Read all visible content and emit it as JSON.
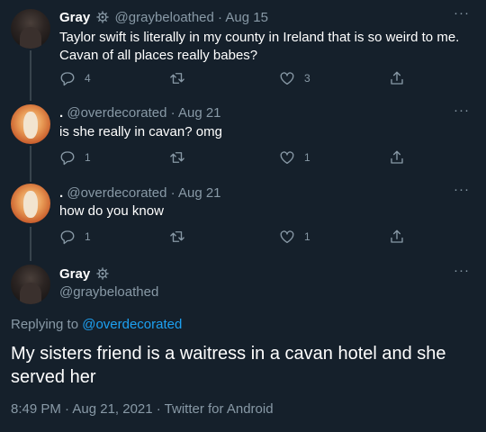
{
  "tweets": [
    {
      "name": "Gray",
      "handle": "@graybeloathed",
      "date": "Aug 15",
      "text_lines": [
        "Taylor swift is literally in my county in Ireland that is so weird to me.",
        "Cavan of all places really babes?"
      ],
      "replies": "4",
      "retweets": "",
      "likes": "3"
    },
    {
      "name": ".",
      "handle": "@overdecorated",
      "date": "Aug 21",
      "text_lines": [
        "is she really in cavan? omg"
      ],
      "replies": "1",
      "retweets": "",
      "likes": "1"
    },
    {
      "name": ".",
      "handle": "@overdecorated",
      "date": "Aug 21",
      "text_lines": [
        "how do you know"
      ],
      "replies": "1",
      "retweets": "",
      "likes": "1"
    }
  ],
  "main_tweet": {
    "name": "Gray",
    "handle": "@graybeloathed",
    "replying_prefix": "Replying to",
    "replying_to": "@overdecorated",
    "text_lines": [
      "My sisters friend is a waitress in a cavan hotel and she",
      "served her"
    ],
    "timestamp": "8:49 PM · Aug 21, 2021 · Twitter for Android"
  },
  "more_label": "···",
  "dot_sep": "·",
  "colors": {
    "background": "#15202b",
    "muted": "#8899a6",
    "link": "#1da1f2",
    "line": "#38444d"
  }
}
